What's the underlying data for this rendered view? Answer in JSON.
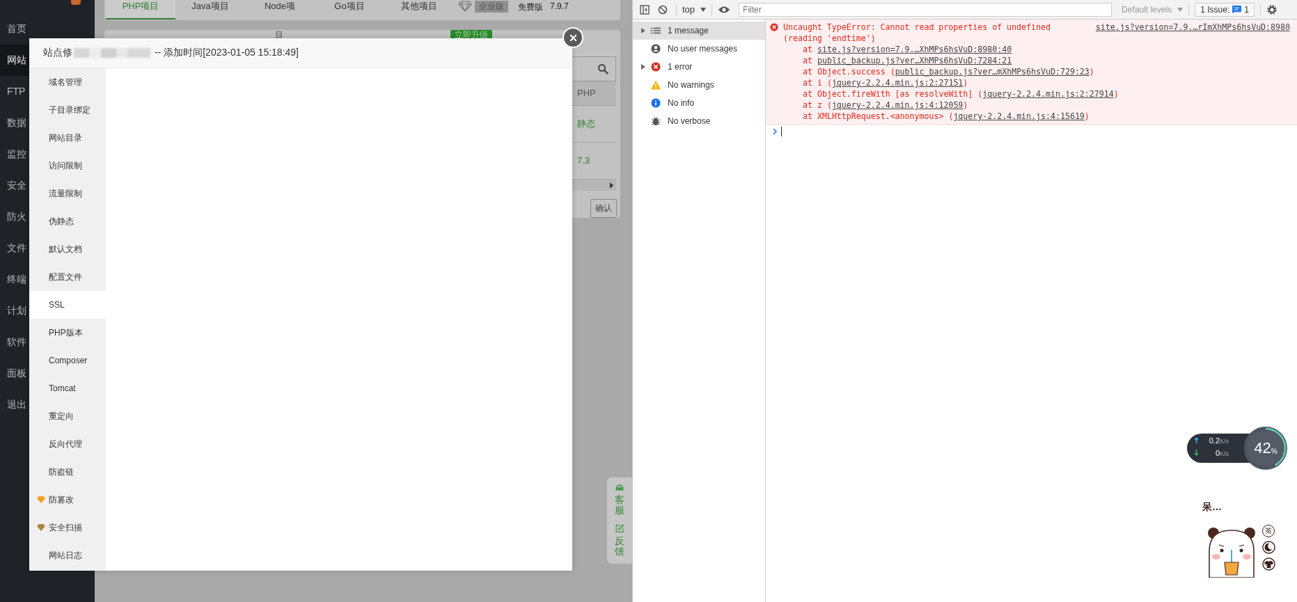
{
  "page": {
    "sidebar": {
      "items": [
        {
          "label": "首页",
          "selected": false
        },
        {
          "label": "网站",
          "selected": true
        },
        {
          "label": "FTP",
          "selected": false
        },
        {
          "label": "数据",
          "selected": false
        },
        {
          "label": "监控",
          "selected": false
        },
        {
          "label": "安全",
          "selected": false
        },
        {
          "label": "防火",
          "selected": false
        },
        {
          "label": "文件",
          "selected": false
        },
        {
          "label": "终端",
          "selected": false
        },
        {
          "label": "计划",
          "selected": false
        },
        {
          "label": "软件",
          "selected": false
        },
        {
          "label": "面板",
          "selected": false
        },
        {
          "label": "退出",
          "selected": false
        }
      ]
    },
    "project_tabs": [
      {
        "label": "PHP项目",
        "selected": true
      },
      {
        "label": "Java项目",
        "selected": false
      },
      {
        "label": "Node项",
        "selected": false
      },
      {
        "label": "Go项目",
        "selected": false
      },
      {
        "label": "其他项目",
        "selected": false
      }
    ],
    "edition_badge": "企业版",
    "version_label": "免费版",
    "version": "7.9.7",
    "card_heading": "目",
    "upgrade_button": "立即升级",
    "table": {
      "header": "PHP",
      "cells": [
        "静态",
        "7.3"
      ]
    },
    "confirm_button": "确认",
    "service_widget": [
      {
        "label": "客服",
        "kind": "support"
      },
      {
        "label": "反馈",
        "kind": "feedback"
      }
    ]
  },
  "modal": {
    "title_prefix": "站点修",
    "title_suffix": "-- 添加时间[2023-01-05 15:18:49]",
    "menu": [
      {
        "label": "域名管理",
        "selected": false,
        "kind": "plain"
      },
      {
        "label": "子目录绑定",
        "selected": false,
        "kind": "plain"
      },
      {
        "label": "网站目录",
        "selected": false,
        "kind": "plain"
      },
      {
        "label": "访问限制",
        "selected": false,
        "kind": "plain"
      },
      {
        "label": "流量限制",
        "selected": false,
        "kind": "plain"
      },
      {
        "label": "伪静态",
        "selected": false,
        "kind": "plain"
      },
      {
        "label": "默认文档",
        "selected": false,
        "kind": "plain"
      },
      {
        "label": "配置文件",
        "selected": false,
        "kind": "plain"
      },
      {
        "label": "SSL",
        "selected": true,
        "kind": "plain"
      },
      {
        "label": "PHP版本",
        "selected": false,
        "kind": "plain"
      },
      {
        "label": "Composer",
        "selected": false,
        "kind": "plain"
      },
      {
        "label": "Tomcat",
        "selected": false,
        "kind": "plain"
      },
      {
        "label": "重定向",
        "selected": false,
        "kind": "plain"
      },
      {
        "label": "反向代理",
        "selected": false,
        "kind": "plain"
      },
      {
        "label": "防盗链",
        "selected": false,
        "kind": "plain"
      },
      {
        "label": "防篡改",
        "selected": false,
        "kind": "premium",
        "color": "#f2a01e"
      },
      {
        "label": "安全扫描",
        "selected": false,
        "kind": "premium",
        "color": "#a8873c"
      },
      {
        "label": "网站日志",
        "selected": false,
        "kind": "plain"
      }
    ]
  },
  "devtools": {
    "context": "top",
    "filter_placeholder": "Filter",
    "levels": "Default levels",
    "issues_label": "1 Issue:",
    "issues_count": "1",
    "sidebar": [
      {
        "label": "1 message",
        "kind": "messages",
        "expandable": true,
        "selected": true
      },
      {
        "label": "No user messages",
        "kind": "user",
        "expandable": false,
        "selected": false
      },
      {
        "label": "1 error",
        "kind": "error",
        "expandable": true,
        "selected": false
      },
      {
        "label": "No warnings",
        "kind": "warning",
        "expandable": false,
        "selected": false
      },
      {
        "label": "No info",
        "kind": "info",
        "expandable": false,
        "selected": false
      },
      {
        "label": "No verbose",
        "kind": "verbose",
        "expandable": false,
        "selected": false
      }
    ],
    "error": {
      "message": "Uncaught TypeError: Cannot read properties of undefined",
      "detail": "(reading 'endtime')",
      "source": "site.js?version=7.9.…rImXhMPs6hsVuD:8980",
      "stack": [
        {
          "prefix": "at ",
          "link": "site.js?version=7.9.…XhMPs6hsVuD:8980:40"
        },
        {
          "prefix": "at ",
          "link": "public_backup.js?ver…XhMPs6hsVuD:7284:21"
        },
        {
          "prefix": "at Object.success (",
          "link": "public_backup.js?ver…mXhMPs6hsVuD:729:23",
          "suffix": ")"
        },
        {
          "prefix": "at i (",
          "link": "jquery-2.2.4.min.js:2:27151",
          "suffix": ")"
        },
        {
          "prefix": "at Object.fireWith [as resolveWith] (",
          "link": "jquery-2.2.4.min.js:2:27914",
          "suffix": ")"
        },
        {
          "prefix": "at z (",
          "link": "jquery-2.2.4.min.js:4:12059",
          "suffix": ")"
        },
        {
          "prefix": "at XMLHttpRequest.<anonymous> (",
          "link": "jquery-2.2.4.min.js:4:15619",
          "suffix": ")"
        }
      ]
    }
  },
  "net_monitor": {
    "upload": "0.2",
    "upload_unit": "K/s",
    "download": "0",
    "download_unit": "K/s",
    "cpu": "42",
    "cpu_unit": "%",
    "level": 0.42
  },
  "sticker": {
    "caption": "呆…",
    "side_buttons": [
      {
        "label": "英",
        "kind": "text"
      },
      {
        "kind": "moon"
      },
      {
        "kind": "shirt"
      }
    ]
  }
}
